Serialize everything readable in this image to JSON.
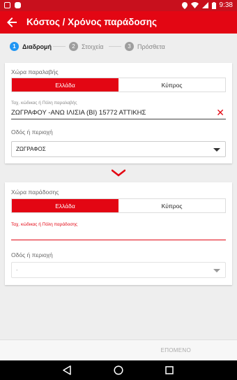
{
  "status_bar": {
    "time": "9:38"
  },
  "app_bar": {
    "title": "Κόστος / Χρόνος παράδοσης"
  },
  "stepper": {
    "steps": [
      {
        "num": "1",
        "label": "Διαδρομή"
      },
      {
        "num": "2",
        "label": "Στοιχεία"
      },
      {
        "num": "3",
        "label": "Πρόσθετα"
      }
    ]
  },
  "pickup": {
    "country_label": "Χώρα παραλαβής",
    "options": [
      "Ελλάδα",
      "Κύπρος"
    ],
    "postal_hint": "Ταχ. κώδικας ή Πόλη παραλαβής",
    "postal_value": "ΖΩΓΡΑΦΟΥ -ΑΝΩ ΙΛΙΣΙΑ (ΒΙ) 15772 ΑΤΤΙΚΗΣ",
    "area_label": "Οδός ή περιοχή",
    "area_value": "ΖΩΓΡΑΦΟΣ"
  },
  "delivery": {
    "country_label": "Χώρα παράδοσης",
    "options": [
      "Ελλάδα",
      "Κύπρος"
    ],
    "postal_hint": "Ταχ. κώδικας ή Πόλη παράδοσης",
    "postal_value": "",
    "area_label": "Οδός ή περιοχή",
    "area_value": "-"
  },
  "footer": {
    "next_label": "ΕΠΟΜΕΝΟ"
  },
  "colors": {
    "accent": "#e30613",
    "status_bar": "#c8101d",
    "step_active": "#2196f3"
  }
}
